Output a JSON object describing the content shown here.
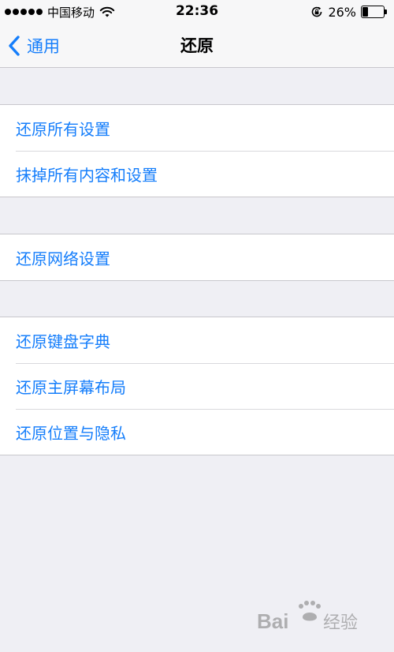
{
  "status_bar": {
    "carrier": "中国移动",
    "time": "22:36",
    "battery_percent": "26%",
    "battery_level": 0.26,
    "signal_dots": 5
  },
  "nav": {
    "back_label": "通用",
    "title": "还原"
  },
  "groups": [
    {
      "items": [
        "还原所有设置",
        "抹掉所有内容和设置"
      ]
    },
    {
      "items": [
        "还原网络设置"
      ]
    },
    {
      "items": [
        "还原键盘字典",
        "还原主屏幕布局",
        "还原位置与隐私"
      ]
    }
  ],
  "watermark": {
    "brand": "Bai",
    "suffix": "经验"
  },
  "colors": {
    "accent": "#157efb",
    "background": "#efeff4",
    "separator": "#c8c7cc"
  }
}
